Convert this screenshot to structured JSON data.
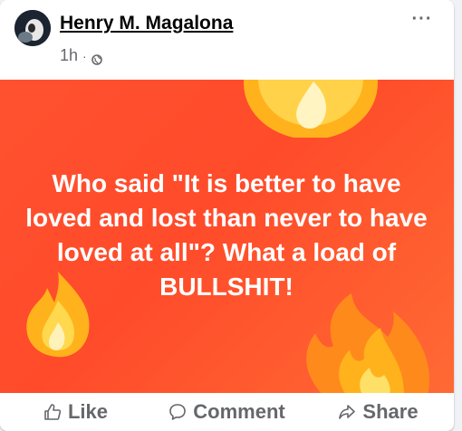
{
  "post": {
    "author": "Henry M. Magalona",
    "time": "1h",
    "separator": "·",
    "privacy_icon": "globe-icon",
    "more_icon": "more-horizontal-icon",
    "more_label": "···",
    "quote": "Who said \"It is better to have loved and lost than never to have loved at all\"? What a load of BULLSHIT!",
    "background_colors": [
      "#ff5130",
      "#ff6a34"
    ],
    "decor_icons": [
      "fire-emoji",
      "fire-emoji",
      "fire-emoji"
    ]
  },
  "actions": [
    {
      "label": "Like",
      "icon": "thumbs-up-icon"
    },
    {
      "label": "Comment",
      "icon": "comment-icon"
    },
    {
      "label": "Share",
      "icon": "share-icon"
    }
  ]
}
